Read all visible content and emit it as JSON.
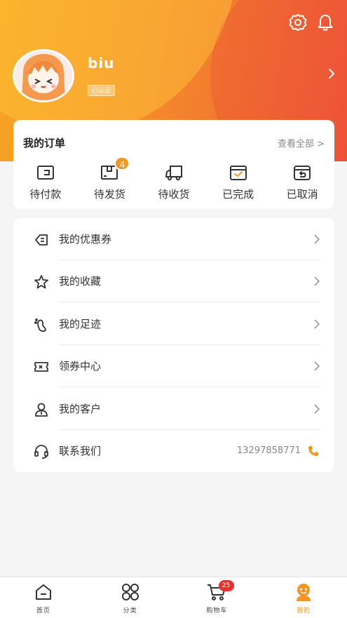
{
  "header": {
    "settings_icon": "gear-icon",
    "notification_icon": "bell-icon",
    "username": "biu",
    "verified_label": "已认证"
  },
  "orders": {
    "title": "我的订单",
    "view_all": "查看全部 >",
    "items": [
      {
        "label": "待付款",
        "icon": "wallet-icon"
      },
      {
        "label": "待发货",
        "icon": "package-icon",
        "badge": "4"
      },
      {
        "label": "待收货",
        "icon": "truck-icon"
      },
      {
        "label": "已完成",
        "icon": "done-icon"
      },
      {
        "label": "已取消",
        "icon": "cancel-icon"
      }
    ]
  },
  "menu": {
    "items": [
      {
        "label": "我的优惠券",
        "icon": "coupon-icon"
      },
      {
        "label": "我的收藏",
        "icon": "star-icon"
      },
      {
        "label": "我的足迹",
        "icon": "footprint-icon"
      },
      {
        "label": "领券中心",
        "icon": "ticket-icon"
      },
      {
        "label": "我的客户",
        "icon": "user-icon"
      },
      {
        "label": "联系我们",
        "icon": "headset-icon",
        "phone": "13297858771"
      }
    ]
  },
  "tabbar": {
    "tabs": [
      {
        "label": "首页",
        "icon": "home-icon"
      },
      {
        "label": "分类",
        "icon": "category-icon"
      },
      {
        "label": "购物车",
        "icon": "cart-icon",
        "badge": "25"
      },
      {
        "label": "我的",
        "icon": "profile-icon",
        "active": true
      }
    ]
  },
  "colors": {
    "accent": "#f39626",
    "header_gradient_start": "#f7a523",
    "header_gradient_end": "#ef5a3a",
    "badge_red": "#e8332d"
  }
}
